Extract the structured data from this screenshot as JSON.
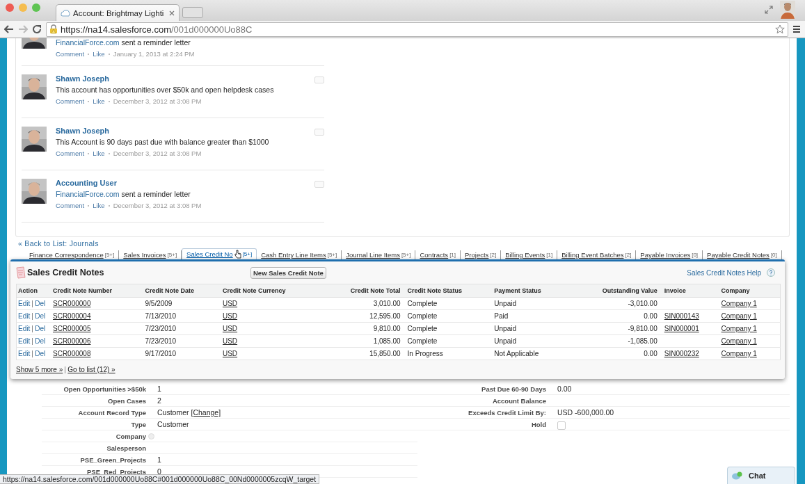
{
  "browser": {
    "tab_title": "Account: Brightmay Lighti",
    "url_host": "https://na14.salesforce.com",
    "url_path": "/001d000000Uo88C"
  },
  "feed": [
    {
      "kind": "system",
      "avatar_cut": true,
      "link": "FinancialForce.com",
      "text": "sent a reminder letter",
      "actions": [
        "Comment",
        "Like"
      ],
      "time": "January 1, 2013 at 2:24 PM"
    },
    {
      "kind": "post",
      "author": "Shawn Joseph",
      "text": "This account has opportunities over $50k and open helpdesk cases",
      "actions": [
        "Comment",
        "Like"
      ],
      "time": "December 3, 2012 at 3:08 PM"
    },
    {
      "kind": "post",
      "author": "Shawn Joseph",
      "text": "This Account is 90 days past due with balance greater than $1000",
      "actions": [
        "Comment",
        "Like"
      ],
      "time": "December 3, 2012 at 3:08 PM"
    },
    {
      "kind": "system",
      "author": "Accounting User",
      "link": "FinancialForce.com",
      "text": "sent a reminder letter",
      "actions": [
        "Comment",
        "Like"
      ],
      "time": "December 3, 2012 at 3:08 PM"
    }
  ],
  "back_link": "« Back to List: Journals",
  "related_tabs": [
    {
      "label": "Finance Correspondence",
      "count": "[5+]",
      "selected": false
    },
    {
      "label": "Sales Invoices",
      "count": "[5+]",
      "selected": false
    },
    {
      "label": "Sales Credit No",
      "count": "[5+]",
      "selected": true
    },
    {
      "label": "Cash Entry Line Items",
      "count": "[5+]",
      "selected": false
    },
    {
      "label": "Journal Line Items",
      "count": "[5+]",
      "selected": false
    },
    {
      "label": "Contracts",
      "count": "[1]",
      "selected": false
    },
    {
      "label": "Projects",
      "count": "[2]",
      "selected": false
    },
    {
      "label": "Billing Events",
      "count": "[1]",
      "selected": false
    },
    {
      "label": "Billing Event Batches",
      "count": "[2]",
      "selected": false
    },
    {
      "label": "Payable Invoices",
      "count": "[0]",
      "selected": false
    },
    {
      "label": "Payable Credit Notes",
      "count": "[0]",
      "selected": false
    }
  ],
  "panel": {
    "title": "Sales Credit Notes",
    "new_button": "New Sales Credit Note",
    "help": "Sales Credit Notes Help",
    "columns": [
      {
        "label": "Action",
        "kind": "action"
      },
      {
        "label": "Credit Note Number",
        "kind": "link"
      },
      {
        "label": "Credit Note Date",
        "kind": "text"
      },
      {
        "label": "Credit Note Currency",
        "kind": "link"
      },
      {
        "label": "Credit Note Total",
        "kind": "number"
      },
      {
        "label": "Credit Note Status",
        "kind": "text"
      },
      {
        "label": "Payment Status",
        "kind": "text"
      },
      {
        "label": "Outstanding Value",
        "kind": "number"
      },
      {
        "label": "Invoice",
        "kind": "link"
      },
      {
        "label": "Company",
        "kind": "link"
      }
    ],
    "rows": [
      {
        "cells": [
          [
            "Edit",
            "Del"
          ],
          "SCR000000",
          "9/5/2009",
          "USD",
          "3,010.00",
          "Complete",
          "Unpaid",
          "-3,010.00",
          "",
          "Company 1"
        ]
      },
      {
        "cells": [
          [
            "Edit",
            "Del"
          ],
          "SCR000004",
          "7/13/2010",
          "USD",
          "12,595.00",
          "Complete",
          "Paid",
          "0.00",
          "SIN000143",
          "Company 1"
        ]
      },
      {
        "cells": [
          [
            "Edit",
            "Del"
          ],
          "SCR000005",
          "7/23/2010",
          "USD",
          "9,810.00",
          "Complete",
          "Unpaid",
          "-9,810.00",
          "SIN000001",
          "Company 1"
        ]
      },
      {
        "cells": [
          [
            "Edit",
            "Del"
          ],
          "SCR000006",
          "7/23/2010",
          "USD",
          "1,085.00",
          "Complete",
          "Unpaid",
          "-1,085.00",
          "",
          "Company 1"
        ]
      },
      {
        "cells": [
          [
            "Edit",
            "Del"
          ],
          "SCR000008",
          "9/17/2010",
          "USD",
          "15,850.00",
          "In Progress",
          "Not Applicable",
          "0.00",
          "SIN000232",
          "Company 1"
        ]
      }
    ],
    "footer_links": [
      "Show 5 more »",
      "Go to list (12) »"
    ]
  },
  "details_left": [
    {
      "label": "Open Opportunities >$50k",
      "value": "1"
    },
    {
      "label": "Open Cases",
      "value": "2"
    },
    {
      "label": "Account Record Type",
      "value": "Customer",
      "link": "[Change]"
    },
    {
      "label": "Type",
      "value": "Customer"
    },
    {
      "label": "Company",
      "info": true
    },
    {
      "label": "Salesperson"
    },
    {
      "label": "PSE_Green_Projects",
      "value": "1"
    },
    {
      "label": "PSE_Red_Projects",
      "value": "0"
    }
  ],
  "details_right": [
    {
      "label": "Past Due 60-90 Days",
      "kind": "text",
      "value": "0.00"
    },
    {
      "label": "Account Balance",
      "kind": "text"
    },
    {
      "label": "Exceeds Credit Limit By:",
      "kind": "text",
      "value": "USD -600,000.00"
    },
    {
      "label": "Hold",
      "kind": "checkbox",
      "checked": false
    }
  ],
  "status_url": "https://na14.salesforce.com/001d000000Uo88C#001d000000Uo88C_00Nd0000005zcqW_target",
  "chat": "Chat"
}
